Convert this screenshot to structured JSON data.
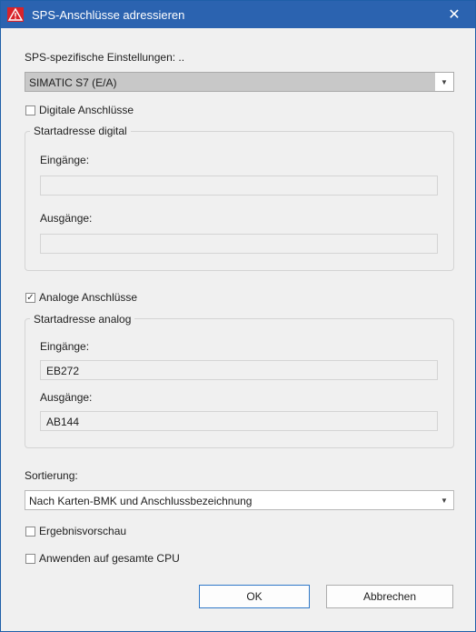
{
  "window": {
    "title": "SPS-Anschlüsse adressieren",
    "close_glyph": "✕",
    "icon": "warning-triangle-icon"
  },
  "plc_settings": {
    "label": "SPS-spezifische Einstellungen: ..",
    "selected": "SIMATIC S7 (E/A)"
  },
  "digital": {
    "checkbox_label": "Digitale Anschlüsse",
    "checked": false,
    "group_title": "Startadresse digital",
    "inputs_label": "Eingänge:",
    "inputs_value": "",
    "outputs_label": "Ausgänge:",
    "outputs_value": ""
  },
  "analog": {
    "checkbox_label": "Analoge Anschlüsse",
    "checked": true,
    "check_glyph": "✓",
    "group_title": "Startadresse analog",
    "inputs_label": "Eingänge:",
    "inputs_value": "EB272",
    "outputs_label": "Ausgänge:",
    "outputs_value": "AB144"
  },
  "sorting": {
    "label": "Sortierung:",
    "selected": "Nach Karten-BMK und Anschlussbezeichnung"
  },
  "options": {
    "preview_label": "Ergebnisvorschau",
    "preview_checked": false,
    "apply_cpu_label": "Anwenden auf gesamte CPU",
    "apply_cpu_checked": false
  },
  "buttons": {
    "ok": "OK",
    "cancel": "Abbrechen"
  },
  "colors": {
    "titlebar": "#2b63b0",
    "icon_red": "#d8232a"
  }
}
